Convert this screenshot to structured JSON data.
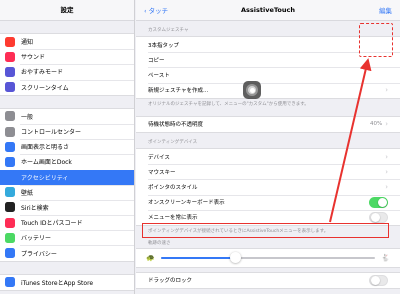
{
  "sidebar": {
    "title": "設定",
    "groups": [
      [
        {
          "label": "通知",
          "icon": "notification-icon",
          "color": "#fe3b30"
        },
        {
          "label": "サウンド",
          "icon": "sound-icon",
          "color": "#fe2d55"
        },
        {
          "label": "おやすみモード",
          "icon": "moon-icon",
          "color": "#5856d6"
        },
        {
          "label": "スクリーンタイム",
          "icon": "hourglass-icon",
          "color": "#5856d6"
        }
      ],
      [
        {
          "label": "一般",
          "icon": "gear-icon",
          "color": "#8e8e93"
        },
        {
          "label": "コントロールセンター",
          "icon": "switches-icon",
          "color": "#8e8e93"
        },
        {
          "label": "画面表示と明るさ",
          "icon": "display-icon",
          "color": "#3478f6"
        },
        {
          "label": "ホーム画面とDock",
          "icon": "home-grid-icon",
          "color": "#3478f6"
        },
        {
          "label": "アクセシビリティ",
          "icon": "accessibility-icon",
          "color": "#3478f6",
          "selected": true
        },
        {
          "label": "壁紙",
          "icon": "wallpaper-icon",
          "color": "#34aadc"
        },
        {
          "label": "Siriと検索",
          "icon": "siri-icon",
          "color": "#222"
        },
        {
          "label": "Touch IDとパスコード",
          "icon": "fingerprint-icon",
          "color": "#fe2d55"
        },
        {
          "label": "バッテリー",
          "icon": "battery-icon",
          "color": "#4cd964"
        },
        {
          "label": "プライバシー",
          "icon": "hand-icon",
          "color": "#3478f6"
        }
      ],
      [
        {
          "label": "iTunes StoreとApp Store",
          "icon": "app-store-icon",
          "color": "#3478f6"
        }
      ]
    ]
  },
  "nav": {
    "back_label": "タッチ",
    "title": "AssistiveTouch",
    "edit_label": "編集"
  },
  "custom_gestures": {
    "header": "カスタムジェスチャ",
    "rows": [
      "3本指タップ",
      "コピー",
      "ペースト"
    ],
    "new_gesture_label": "新規ジェスチャを作成...",
    "footer": "オリジナルのジェスチャを記録して、メニューの\"カスタム\"から使用できます。"
  },
  "idle_opacity": {
    "label": "待機状態時の不透明度",
    "value": "40%"
  },
  "pointing_devices": {
    "header": "ポインティングデバイス",
    "rows": [
      "デバイス",
      "マウスキー",
      "ポインタのスタイル"
    ],
    "onscreen_keyboard_label": "オンスクリーンキーボード表示",
    "always_show_menu_label": "メニューを常に表示",
    "footer": "ポインティングデバイスが接続されているときにAssistiveTouchメニューを表示します。"
  },
  "tracking_speed": {
    "header": "軌跡の速さ",
    "fraction": 0.35
  },
  "drag_lock_label": "ドラッグのロック",
  "colors": {
    "accent": "#3478f6",
    "highlight": "#e8322f",
    "toggle_on": "#4cd964"
  }
}
